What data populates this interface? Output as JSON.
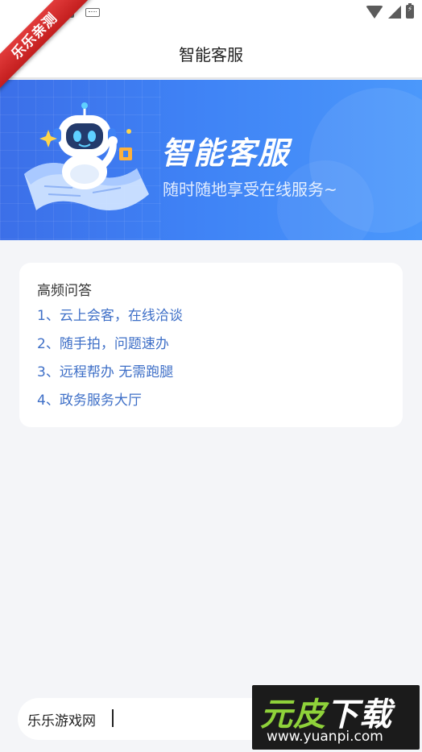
{
  "ribbon": {
    "text": "乐乐亲测"
  },
  "status_bar": {
    "icon_left_1": "A"
  },
  "header": {
    "back_icon": "back-arrow-icon",
    "title": "智能客服"
  },
  "banner": {
    "title": "智能客服",
    "subtitle": "随时随地享受在线服务~"
  },
  "faq": {
    "heading": "高频问答",
    "items": [
      "1、云上会客，在线洽谈",
      "2、随手拍，问题速办",
      "3、远程帮办 无需跑腿",
      "4、政务服务大厅"
    ]
  },
  "input": {
    "value": "乐乐游戏网"
  },
  "watermark": {
    "title_a": "元皮",
    "title_b": "下载",
    "url": "www.yuanpi.com"
  },
  "colors": {
    "accent": "#3e6fc7",
    "banner": "#3f82f5",
    "ribbon": "#d22a2a"
  }
}
